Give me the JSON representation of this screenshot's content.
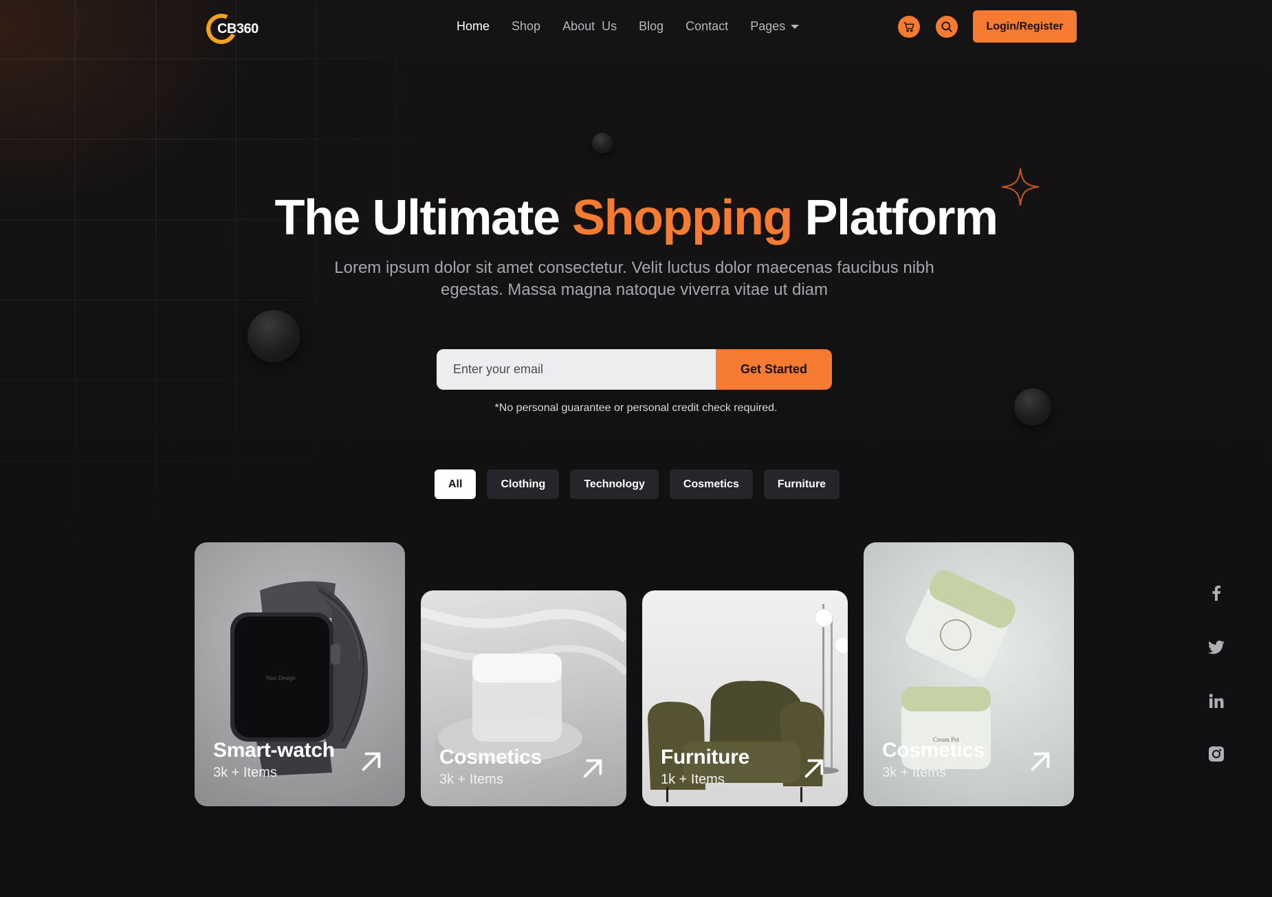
{
  "logo": {
    "text": "CB360"
  },
  "nav": {
    "items": [
      {
        "label": "Home",
        "active": true
      },
      {
        "label": "Shop"
      },
      {
        "label": "About  Us"
      },
      {
        "label": "Blog"
      },
      {
        "label": "Contact"
      },
      {
        "label": "Pages",
        "has_dropdown": true
      }
    ],
    "cart_icon": "cart-icon",
    "search_icon": "search-icon",
    "login_label": "Login/Register"
  },
  "hero": {
    "title_before": "The Ultimate ",
    "title_accent": "Shopping",
    "title_after": " Platform",
    "subtitle": "Lorem ipsum dolor sit amet consectetur. Velit luctus dolor maecenas faucibus nibh egestas. Massa magna natoque viverra vitae ut diam",
    "email_placeholder": "Enter your email",
    "cta_label": "Get Started",
    "disclaimer": "*No personal guarantee or personal credit check required."
  },
  "filters": [
    {
      "label": "All",
      "active": true
    },
    {
      "label": "Clothing"
    },
    {
      "label": "Technology"
    },
    {
      "label": "Cosmetics"
    },
    {
      "label": "Furniture"
    }
  ],
  "cards": [
    {
      "title": "Smart-watch",
      "count": "3k + Items",
      "watch_screen_text": "Your Design"
    },
    {
      "title": "Cosmetics",
      "count": "3k + Items"
    },
    {
      "title": "Furniture",
      "count": "1k + Items"
    },
    {
      "title": "Cosmetics",
      "count": "3k + Items",
      "jar_label": "Cream Pot"
    }
  ],
  "social": [
    "facebook-icon",
    "twitter-icon",
    "linkedin-icon",
    "instagram-icon"
  ],
  "colors": {
    "accent": "#f47b31",
    "background": "#121112",
    "logo_ring": "#f5a21b"
  }
}
